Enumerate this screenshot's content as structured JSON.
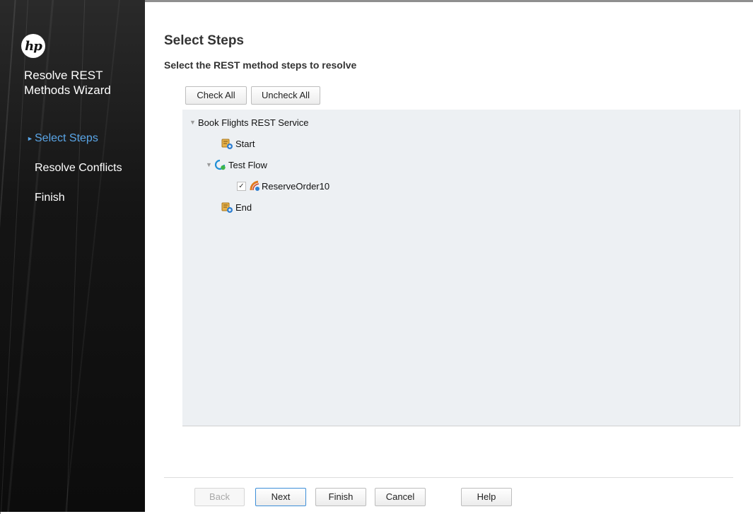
{
  "sidebar": {
    "logo_text": "hp",
    "wizard_title": "Resolve REST Methods Wizard",
    "steps": [
      {
        "label": "Select Steps",
        "active": true
      },
      {
        "label": "Resolve Conflicts",
        "active": false
      },
      {
        "label": "Finish",
        "active": false
      }
    ],
    "active_color": "#5aa6e8"
  },
  "main": {
    "title": "Select Steps",
    "subtitle": "Select the REST method steps to resolve",
    "check_all_label": "Check All",
    "uncheck_all_label": "Uncheck All",
    "tree": {
      "root": {
        "label": "Book Flights REST Service",
        "expanded": true
      },
      "start": {
        "label": "Start",
        "icon": "step-icon"
      },
      "flow": {
        "label": "Test Flow",
        "icon": "flow-icon",
        "expanded": true
      },
      "method": {
        "label": "ReserveOrder10",
        "icon": "rest-method-icon",
        "checked": true
      },
      "end": {
        "label": "End",
        "icon": "step-icon"
      }
    }
  },
  "footer": {
    "back_label": "Back",
    "next_label": "Next",
    "finish_label": "Finish",
    "cancel_label": "Cancel",
    "help_label": "Help"
  }
}
